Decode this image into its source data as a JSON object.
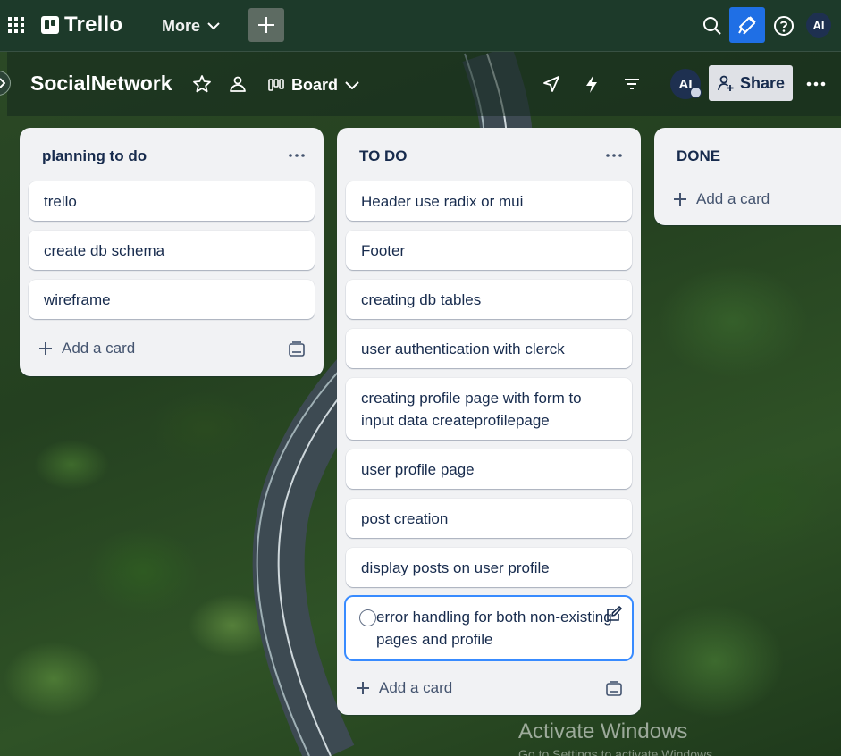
{
  "topbar": {
    "logo": "Trello",
    "more_label": "More",
    "avatar_initials": "AI"
  },
  "board": {
    "title": "SocialNetwork",
    "view_label": "Board",
    "member_initials": "AI",
    "share_label": "Share"
  },
  "lists": [
    {
      "title": "planning to do",
      "cards": [
        "trello",
        "create db schema",
        "wireframe"
      ],
      "add_label": "Add a card"
    },
    {
      "title": "TO DO",
      "cards": [
        "Header use radix or mui",
        "Footer",
        "creating db tables",
        "user authentication with clerck",
        "creating profile page with form to input data createprofilepage",
        "user profile page",
        "post creation",
        "display posts on user profile",
        "error handling for both non-existing pages and profile"
      ],
      "add_label": "Add a card"
    },
    {
      "title": "DONE",
      "cards": [],
      "add_label": "Add a card"
    }
  ],
  "watermark": {
    "title": "Activate Windows",
    "subtitle": "Go to Settings to activate Windows."
  },
  "colors": {
    "topbar": "#1d3a2a",
    "accent": "#1f6fe5",
    "list_bg": "#f1f2f4",
    "card_text": "#172b4d"
  }
}
